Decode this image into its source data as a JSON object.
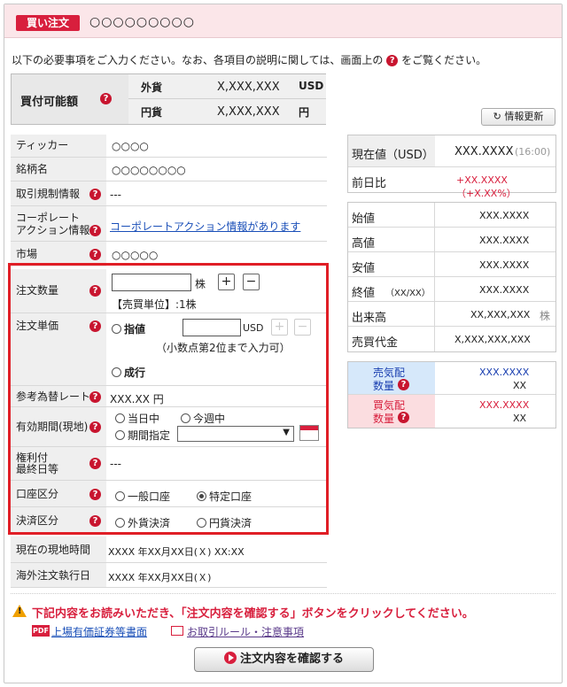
{
  "header": {
    "badge": "買い注文",
    "title": "○○○○○○○○○"
  },
  "intro": {
    "before": "以下の必要事項をご入力ください。なお、各項目の説明に関しては、画面上の",
    "after": "をご覧ください。"
  },
  "help_icon_glyph": "?",
  "buying_power": {
    "label": "買付可能額",
    "rows": [
      {
        "currency": "外貨",
        "amount": "X,XXX,XXX",
        "unit": "USD"
      },
      {
        "currency": "円貨",
        "amount": "X,XXX,XXX",
        "unit": "円"
      }
    ]
  },
  "refresh_button": "情報更新",
  "form": {
    "ticker": {
      "label": "ティッカー",
      "value": "○○○○"
    },
    "name": {
      "label": "銘柄名",
      "value": "○○○○○○○○"
    },
    "regulation": {
      "label": "取引規制情報",
      "value": "---"
    },
    "corporate_action": {
      "label1": "コーポレート",
      "label2": "アクション情報",
      "value": "コーポレートアクション情報があります"
    },
    "market": {
      "label": "市場",
      "value": "○○○○○"
    },
    "quantity": {
      "label": "注文数量",
      "value": "",
      "unit": "株",
      "plus": "+",
      "minus": "−",
      "note": "【売買単位】:1株"
    },
    "price": {
      "label": "注文単価",
      "limit_label": "指値",
      "value": "",
      "unit": "USD",
      "plus": "+",
      "minus": "−",
      "note": "（小数点第2位まで入力可）",
      "market_label": "成行"
    },
    "fx_rate": {
      "label": "参考為替レート",
      "value": "XXX.XX 円"
    },
    "validity": {
      "label": "有効期間(現地)",
      "options": [
        "当日中",
        "今週中",
        "期間指定"
      ],
      "select_value": ""
    },
    "rights_date": {
      "label1": "権利付",
      "label2": "最終日等",
      "value": "---"
    },
    "account": {
      "label": "口座区分",
      "options": [
        "一般口座",
        "特定口座"
      ],
      "selected": "特定口座"
    },
    "settlement": {
      "label": "決済区分",
      "options": [
        "外貨決済",
        "円貨決済"
      ]
    },
    "local_time": {
      "label": "現在の現地時間",
      "value": "XXXX 年XX月XX日(Ｘ) XX:XX"
    },
    "exec_date": {
      "label": "海外注文執行日",
      "value": "XXXX 年XX月XX日(Ｘ)"
    }
  },
  "quote": {
    "current": {
      "label": "現在値（USD）",
      "value": "XXX.XXXX",
      "time": "(16:00)"
    },
    "change": {
      "label": "前日比",
      "value": "+XX.XXXX（+X.XX%）"
    },
    "open": {
      "label": "始値",
      "value": "XXX.XXXX"
    },
    "high": {
      "label": "高値",
      "value": "XXX.XXXX"
    },
    "low": {
      "label": "安値",
      "value": "XXX.XXXX"
    },
    "close": {
      "label": "終値",
      "label_note": "（XX/XX）",
      "value": "XXX.XXXX"
    },
    "volume": {
      "label": "出来高",
      "value": "XX,XXX,XXX",
      "unit": "株"
    },
    "turnover": {
      "label": "売買代金",
      "value": "X,XXX,XXX,XXX"
    }
  },
  "board": {
    "sell": {
      "label1": "売気配",
      "label2": "数量",
      "price": "XXX.XXXX",
      "qty": "XX"
    },
    "buy": {
      "label1": "買気配",
      "label2": "数量",
      "price": "XXX.XXXX",
      "qty": "XX"
    }
  },
  "warning": "下記内容をお読みいただき、「注文内容を確認する」ボタンをクリックしてください。",
  "links": {
    "pdf_icon": "PDF",
    "prospectus": "上場有価証券等書面",
    "rules": "お取引ルール・注意事項"
  },
  "confirm_button": "注文内容を確認する",
  "colors": {
    "accent": "#d81f3d",
    "header_bg": "#fbe6e9",
    "link": "#1a4fb8",
    "highlight_border": "#e01e26"
  }
}
